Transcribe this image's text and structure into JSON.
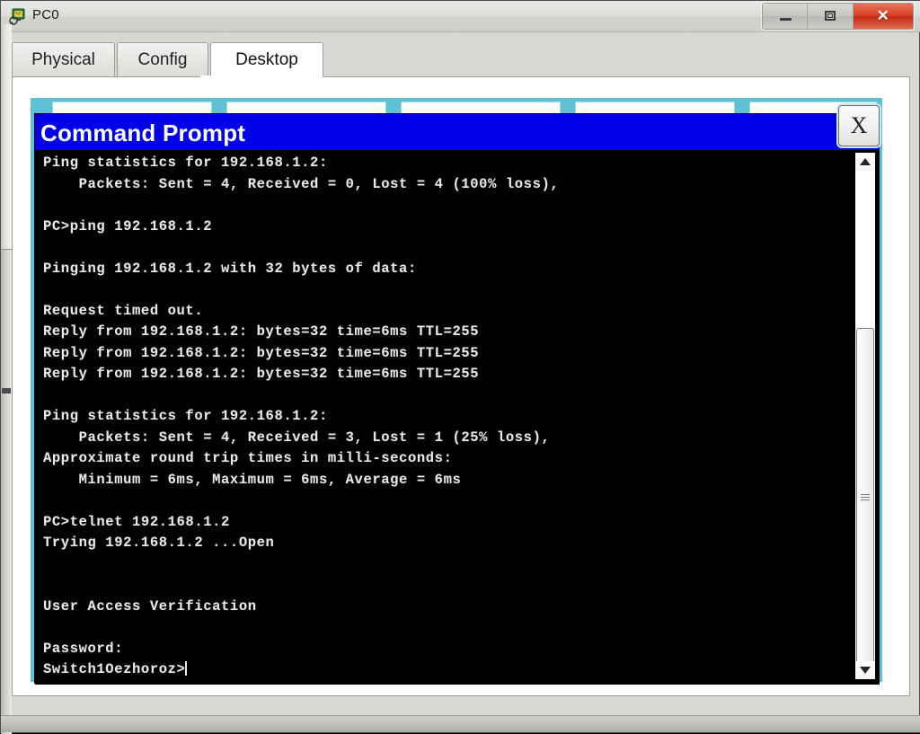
{
  "window": {
    "title": "PC0",
    "icon": "pc-device-icon",
    "buttons": {
      "minimize": "minimize-icon",
      "maximize": "maximize-icon",
      "close": "✕"
    }
  },
  "tabs": [
    {
      "label": "Physical",
      "active": false
    },
    {
      "label": "Config",
      "active": false
    },
    {
      "label": "Desktop",
      "active": true
    }
  ],
  "desktop": {
    "background_color": "#5fc1d6",
    "tile_count": 5
  },
  "command_prompt": {
    "title": "Command Prompt",
    "close_label": "X",
    "background_color": "#000000",
    "titlebar_color": "#0000e8",
    "text_color": "#e9e9e9",
    "lines": [
      "Ping statistics for 192.168.1.2:",
      "    Packets: Sent = 4, Received = 0, Lost = 4 (100% loss),",
      "",
      "PC>ping 192.168.1.2",
      "",
      "Pinging 192.168.1.2 with 32 bytes of data:",
      "",
      "Request timed out.",
      "Reply from 192.168.1.2: bytes=32 time=6ms TTL=255",
      "Reply from 192.168.1.2: bytes=32 time=6ms TTL=255",
      "Reply from 192.168.1.2: bytes=32 time=6ms TTL=255",
      "",
      "Ping statistics for 192.168.1.2:",
      "    Packets: Sent = 4, Received = 3, Lost = 1 (25% loss),",
      "Approximate round trip times in milli-seconds:",
      "    Minimum = 6ms, Maximum = 6ms, Average = 6ms",
      "",
      "PC>telnet 192.168.1.2",
      "Trying 192.168.1.2 ...Open",
      "",
      "",
      "User Access Verification",
      "",
      "Password:",
      "Switch1Oezhoroz>"
    ],
    "prompt": "Switch1Oezhoroz>",
    "scrollbar": {
      "up_arrow": "scroll-up-icon",
      "down_arrow": "scroll-down-icon",
      "thumb": "scroll-thumb"
    }
  }
}
